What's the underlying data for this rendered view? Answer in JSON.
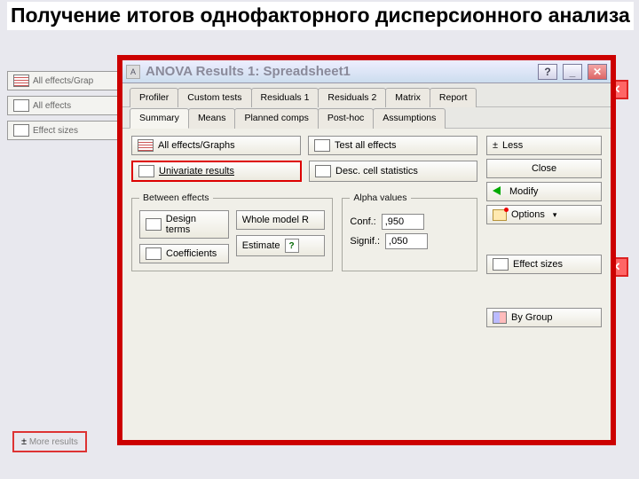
{
  "page_heading": "Получение итогов однофакторного дисперсионного анализа",
  "bg": {
    "left_buttons": [
      "All effects/Grap",
      "All effects",
      "Effect sizes"
    ],
    "more_results": "More results"
  },
  "dialog": {
    "title": "ANOVA Results 1: Spreadsheet1",
    "titlebar": {
      "help": "?",
      "min": "_",
      "close": "✕"
    },
    "tabs_row1": [
      "Profiler",
      "Custom tests",
      "Residuals 1",
      "Residuals 2",
      "Matrix",
      "Report"
    ],
    "tabs_row2": [
      "Summary",
      "Means",
      "Planned comps",
      "Post-hoc",
      "Assumptions"
    ],
    "summary": {
      "all_effects": "All effects/Graphs",
      "test_all": "Test all effects",
      "univariate": "Univariate results",
      "desc_cell": "Desc. cell statistics"
    },
    "between": {
      "legend": "Between effects",
      "design_terms": "Design terms",
      "whole_model": "Whole model R",
      "coefficients": "Coefficients",
      "estimate": "Estimate"
    },
    "alpha": {
      "legend": "Alpha values",
      "conf_label": "Conf.:",
      "conf_value": ",950",
      "signif_label": "Signif.:",
      "signif_value": ",050"
    },
    "side": {
      "less": "Less",
      "close": "Close",
      "modify": "Modify",
      "options": "Options",
      "by_group": "By Group"
    }
  }
}
